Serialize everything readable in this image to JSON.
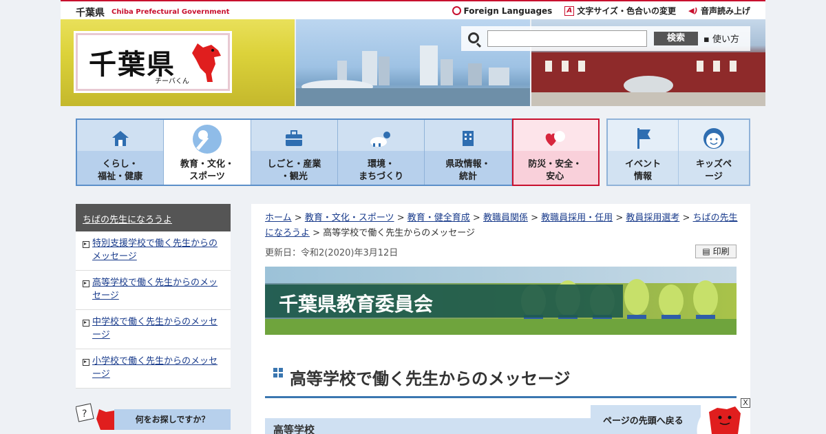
{
  "header": {
    "site_name": "千葉県",
    "site_sub": "Chiba Prefectural Government",
    "links": {
      "foreign": "Foreign Languages",
      "text_size": "文字サイズ・色合いの変更",
      "voice": "音声読み上げ"
    },
    "logo_text": "千葉県",
    "logo_sub": "チーバくん",
    "search": {
      "placeholder": "",
      "button": "検索",
      "help": "使い方"
    }
  },
  "nav": {
    "items": [
      {
        "label": "くらし・\n福祉・健康",
        "icon": "house-icon"
      },
      {
        "label": "教育・文化・\nスポーツ",
        "icon": "baseball-icon"
      },
      {
        "label": "しごと・産業\n・観光",
        "icon": "briefcase-icon"
      },
      {
        "label": "環境・\nまちづくり",
        "icon": "weather-icon"
      },
      {
        "label": "県政情報・\n統計",
        "icon": "building-icon"
      },
      {
        "label": "防災・安全・\n安心",
        "icon": "heart-icon"
      }
    ],
    "extra": [
      {
        "label": "イベント\n情報",
        "icon": "flag-icon"
      },
      {
        "label": "キッズペ\nージ",
        "icon": "kid-face-icon"
      }
    ]
  },
  "sidebar": {
    "heading": "ちばの先生になろうよ",
    "items": [
      "特別支援学校で働く先生からのメッセージ",
      "高等学校で働く先生からのメッセージ",
      "中学校で働く先生からのメッセージ",
      "小学校で働く先生からのメッセージ"
    ],
    "search_prompt": "何をお探しですか？"
  },
  "breadcrumb": {
    "links": [
      "ホーム",
      "教育・文化・スポーツ",
      "教育・健全育成",
      "教職員関係",
      "教職員採用・任用",
      "教員採用選考",
      "ちばの先生になろうよ"
    ],
    "current": "高等学校で働く先生からのメッセージ",
    "sep": ">"
  },
  "page": {
    "updated": "更新日：令和2(2020)年3月12日",
    "print": "印刷",
    "hero_title": "千葉県教育委員会",
    "title": "高等学校で働く先生からのメッセージ",
    "section": "高等学校"
  },
  "floating": {
    "back_to_top": "ページの先頭へ戻る",
    "close": "X"
  },
  "colors": {
    "brand_red": "#c8102e",
    "nav_blue": "#5b8fc9",
    "link": "#1a3c8c"
  }
}
